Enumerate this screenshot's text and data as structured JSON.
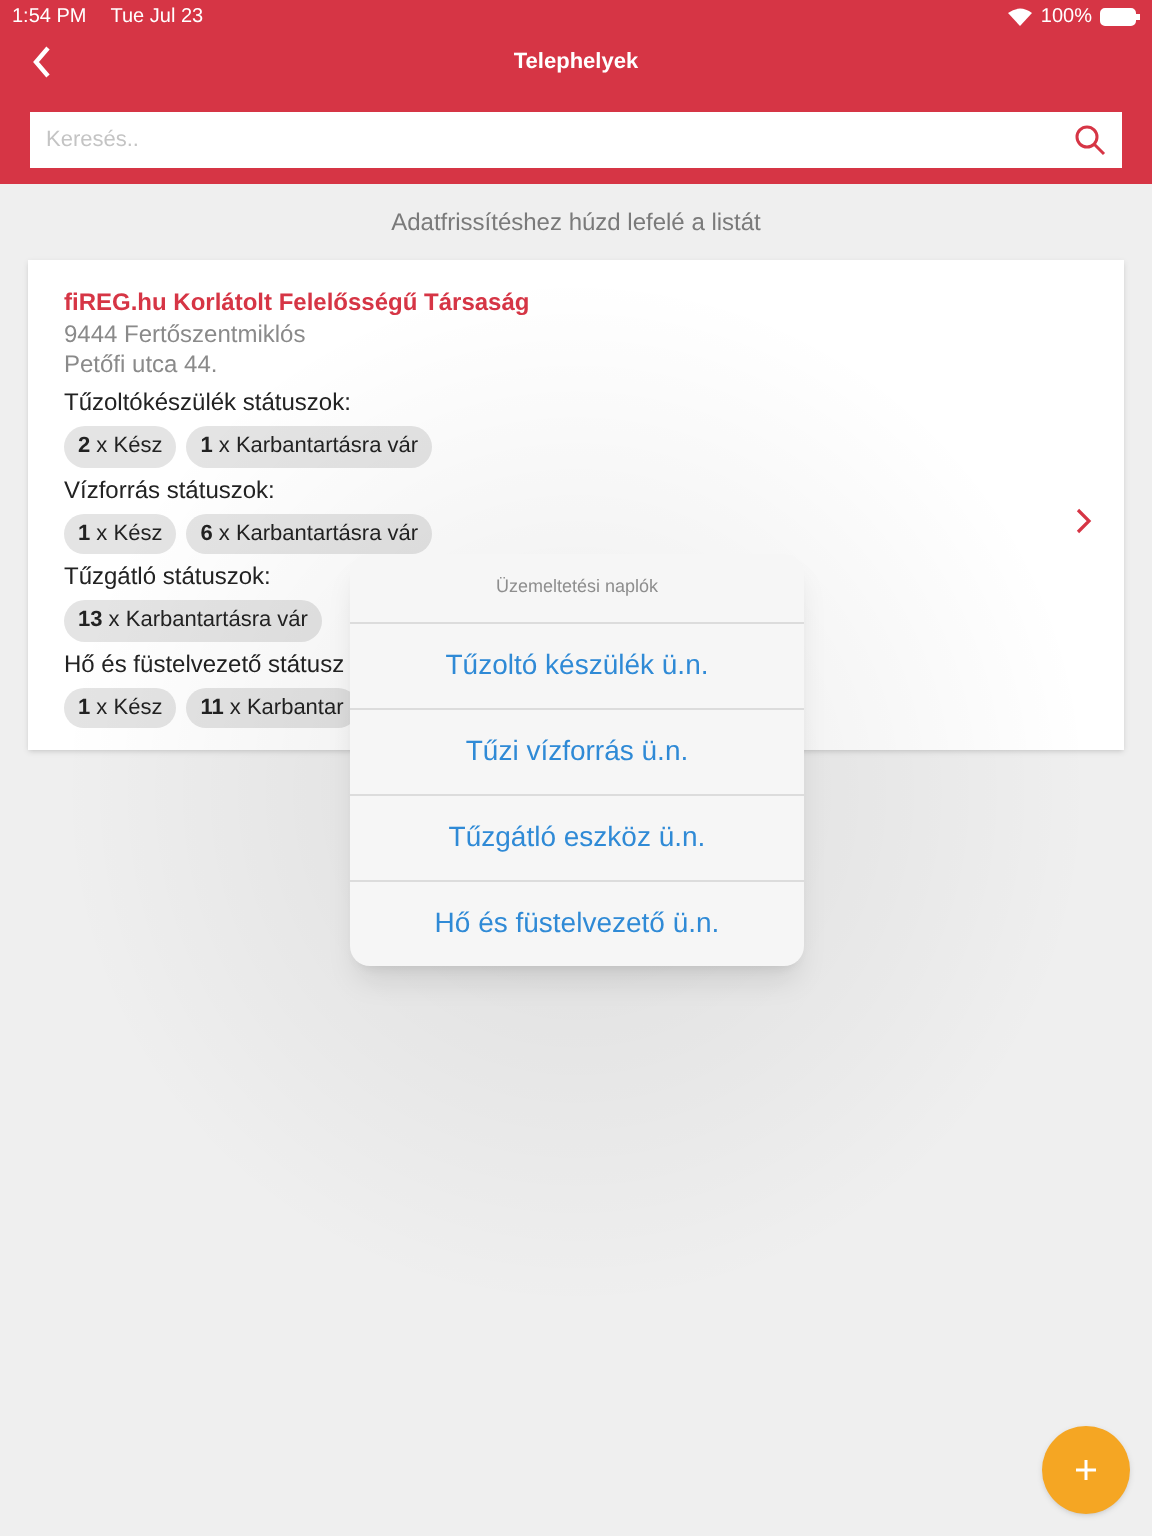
{
  "status_bar": {
    "time": "1:54 PM",
    "date": "Tue Jul 23",
    "battery": "100%"
  },
  "header": {
    "title": "Telephelyek"
  },
  "search": {
    "placeholder": "Keresés.."
  },
  "pull_hint": "Adatfrissítéshez húzd lefelé a listát",
  "site": {
    "name": "fiREG.hu Korlátolt Felelősségű Társaság",
    "address_lines": [
      "9444 Fertőszentmiklós",
      "Petőfi utca 44."
    ],
    "groups": [
      {
        "label": "Tűzoltókészülék státuszok:",
        "chips": [
          "**2** x Kész",
          "**1** x Karbantartásra vár"
        ]
      },
      {
        "label": "Vízforrás státuszok:",
        "chips": [
          "**1** x Kész",
          "**6** x Karbantartásra vár"
        ]
      },
      {
        "label": "Tűzgátló státuszok:",
        "chips": [
          "**13** x Karbantartásra vár"
        ]
      },
      {
        "label": "Hő és füstelvezető státusz",
        "chips": [
          "**1** x Kész",
          "**11** x Karbantar"
        ]
      }
    ]
  },
  "popover": {
    "title": "Üzemeltetési naplók",
    "items": [
      "Tűzoltó készülék ü.n.",
      "Tűzi vízforrás ü.n.",
      "Tűzgátló eszköz ü.n.",
      "Hő és füstelvezető ü.n."
    ]
  }
}
